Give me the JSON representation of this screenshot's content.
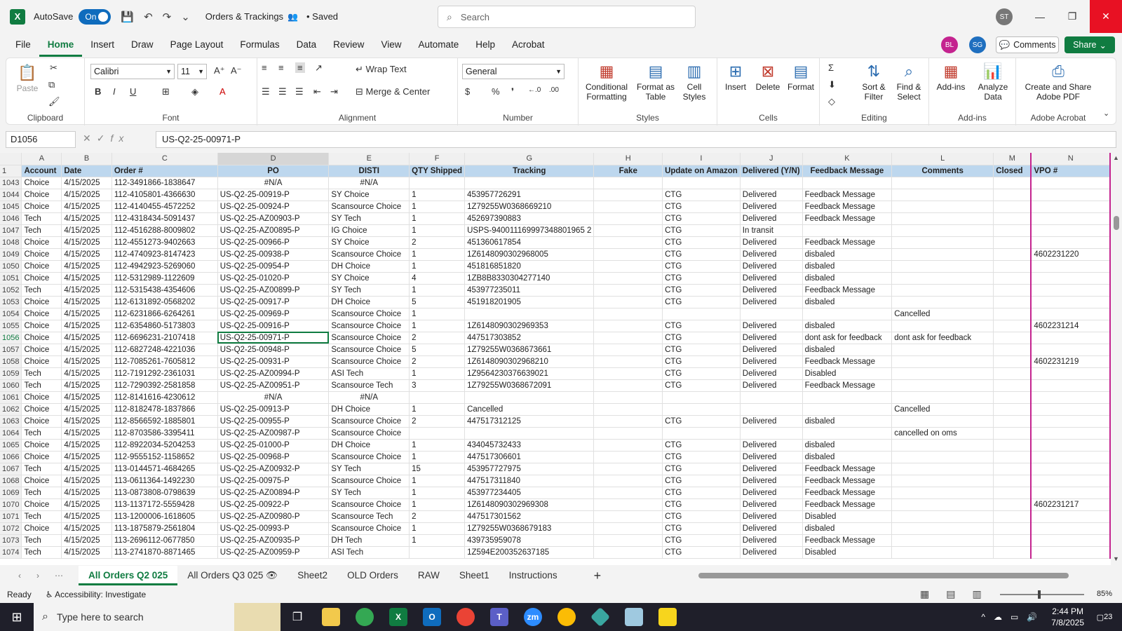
{
  "titlebar": {
    "autosave_label": "AutoSave",
    "autosave_state": "On",
    "doc_title": "Orders & Trackings",
    "saved": "• Saved",
    "search_placeholder": "Search",
    "user_initials": "ST",
    "minimize": "—",
    "maximize": "❐",
    "close": "✕"
  },
  "tabs": [
    "File",
    "Home",
    "Insert",
    "Draw",
    "Page Layout",
    "Formulas",
    "Data",
    "Review",
    "View",
    "Automate",
    "Help",
    "Acrobat"
  ],
  "collab": {
    "bl": "BL",
    "sg": "SG",
    "comments": "Comments",
    "share": "Share"
  },
  "ribbon": {
    "clipboard": {
      "label": "Clipboard",
      "paste": "Paste"
    },
    "font": {
      "label": "Font",
      "family": "Calibri",
      "size": "11"
    },
    "alignment": {
      "label": "Alignment",
      "wrap": "Wrap Text",
      "merge": "Merge & Center"
    },
    "number": {
      "label": "Number",
      "format": "General"
    },
    "styles": {
      "label": "Styles",
      "conditional": "Conditional Formatting",
      "format_table": "Format as Table",
      "cell_styles": "Cell Styles"
    },
    "cells": {
      "label": "Cells",
      "insert": "Insert",
      "delete": "Delete",
      "format": "Format"
    },
    "editing": {
      "label": "Editing",
      "sort": "Sort & Filter",
      "find": "Find & Select"
    },
    "addins": {
      "label": "Add-ins",
      "addins": "Add-ins",
      "analyze": "Analyze Data"
    },
    "acrobat": {
      "label": "Adobe Acrobat",
      "create": "Create and Share Adobe PDF"
    }
  },
  "formula_bar": {
    "name_box": "D1056",
    "formula": "US-Q2-25-00971-P"
  },
  "grid": {
    "col_letters": [
      "A",
      "B",
      "C",
      "D",
      "E",
      "F",
      "G",
      "H",
      "I",
      "J",
      "K",
      "L",
      "M",
      "N"
    ],
    "header_row_num": "1",
    "headers": [
      "Account",
      "Date",
      "Order #",
      "PO",
      "DISTI",
      "QTY Shipped",
      "Tracking",
      "Fake",
      "Update on Amazon",
      "Delivered (Y/N)",
      "Feedback Message",
      "Comments",
      "Closed",
      "VPO #"
    ],
    "rows": [
      [
        "1043",
        "Choice",
        "4/15/2025",
        "112-3491866-1838647",
        "#N/A",
        "#N/A",
        "",
        "",
        "",
        "",
        "",
        "",
        "",
        "",
        ""
      ],
      [
        "1044",
        "Choice",
        "4/15/2025",
        "112-4105801-4366630",
        "US-Q2-25-00919-P",
        "SY Choice",
        "1",
        "453957726291",
        "",
        "CTG",
        "Delivered",
        "Feedback Message",
        "",
        "",
        ""
      ],
      [
        "1045",
        "Choice",
        "4/15/2025",
        "112-4140455-4572252",
        "US-Q2-25-00924-P",
        "Scansource Choice",
        "1",
        "1Z79255W0368669210",
        "",
        "CTG",
        "Delivered",
        "Feedback Message",
        "",
        "",
        ""
      ],
      [
        "1046",
        "Tech",
        "4/15/2025",
        "112-4318434-5091437",
        "US-Q2-25-AZ00903-P",
        "SY Tech",
        "1",
        "452697390883",
        "",
        "CTG",
        "Delivered",
        "Feedback Message",
        "",
        "",
        ""
      ],
      [
        "1047",
        "Tech",
        "4/15/2025",
        "112-4516288-8009802",
        "US-Q2-25-AZ00895-P",
        "IG Choice",
        "1",
        "USPS-940011169997348801965 2",
        "",
        "CTG",
        "In transit",
        "",
        "",
        "",
        ""
      ],
      [
        "1048",
        "Choice",
        "4/15/2025",
        "112-4551273-9402663",
        "US-Q2-25-00966-P",
        "SY Choice",
        "2",
        "451360617854",
        "",
        "CTG",
        "Delivered",
        "Feedback Message",
        "",
        "",
        ""
      ],
      [
        "1049",
        "Choice",
        "4/15/2025",
        "112-4740923-8147423",
        "US-Q2-25-00938-P",
        "Scansource Choice",
        "1",
        "1Z6148090302968005",
        "",
        "CTG",
        "Delivered",
        "disbaled",
        "",
        "",
        "4602231220"
      ],
      [
        "1050",
        "Choice",
        "4/15/2025",
        "112-4942923-5269060",
        "US-Q2-25-00954-P",
        "DH Choice",
        "1",
        "451816851820",
        "",
        "CTG",
        "Delivered",
        "disbaled",
        "",
        "",
        ""
      ],
      [
        "1051",
        "Choice",
        "4/15/2025",
        "112-5312989-1122609",
        "US-Q2-25-01020-P",
        "SY Choice",
        "4",
        "1ZB8B8330304277140",
        "",
        "CTG",
        "Delivered",
        "disbaled",
        "",
        "",
        ""
      ],
      [
        "1052",
        "Tech",
        "4/15/2025",
        "112-5315438-4354606",
        "US-Q2-25-AZ00899-P",
        "SY Tech",
        "1",
        "453977235011",
        "",
        "CTG",
        "Delivered",
        "Feedback Message",
        "",
        "",
        ""
      ],
      [
        "1053",
        "Choice",
        "4/15/2025",
        "112-6131892-0568202",
        "US-Q2-25-00917-P",
        "DH Choice",
        "5",
        "451918201905",
        "",
        "CTG",
        "Delivered",
        "disbaled",
        "",
        "",
        ""
      ],
      [
        "1054",
        "Choice",
        "4/15/2025",
        "112-6231866-6264261",
        "US-Q2-25-00969-P",
        "Scansource Choice",
        "1",
        "",
        "",
        "",
        "",
        "",
        "Cancelled",
        "",
        ""
      ],
      [
        "1055",
        "Choice",
        "4/15/2025",
        "112-6354860-5173803",
        "US-Q2-25-00916-P",
        "Scansource Choice",
        "1",
        "1Z6148090302969353",
        "",
        "CTG",
        "Delivered",
        "disbaled",
        "",
        "",
        "4602231214"
      ],
      [
        "1056",
        "Choice",
        "4/15/2025",
        "112-6696231-2107418",
        "US-Q2-25-00971-P",
        "Scansource Choice",
        "2",
        "447517303852",
        "",
        "CTG",
        "Delivered",
        "dont ask for feedback",
        "dont ask for feedback",
        "",
        ""
      ],
      [
        "1057",
        "Choice",
        "4/15/2025",
        "112-6827248-4221036",
        "US-Q2-25-00948-P",
        "Scansource Choice",
        "5",
        "1Z79255W0368673661",
        "",
        "CTG",
        "Delivered",
        "disbaled",
        "",
        "",
        ""
      ],
      [
        "1058",
        "Choice",
        "4/15/2025",
        "112-7085261-7605812",
        "US-Q2-25-00931-P",
        "Scansource Choice",
        "2",
        "1Z6148090302968210",
        "",
        "CTG",
        "Delivered",
        "Feedback Message",
        "",
        "",
        "4602231219"
      ],
      [
        "1059",
        "Tech",
        "4/15/2025",
        "112-7191292-2361031",
        "US-Q2-25-AZ00994-P",
        "ASI Tech",
        "1",
        "1Z9564230376639021",
        "",
        "CTG",
        "Delivered",
        "Disabled",
        "",
        "",
        ""
      ],
      [
        "1060",
        "Tech",
        "4/15/2025",
        "112-7290392-2581858",
        "US-Q2-25-AZ00951-P",
        "Scansource Tech",
        "3",
        "1Z79255W0368672091",
        "",
        "CTG",
        "Delivered",
        "Feedback Message",
        "",
        "",
        ""
      ],
      [
        "1061",
        "Choice",
        "4/15/2025",
        "112-8141616-4230612",
        "#N/A",
        "#N/A",
        "",
        "",
        "",
        "",
        "",
        "",
        "",
        "",
        ""
      ],
      [
        "1062",
        "Choice",
        "4/15/2025",
        "112-8182478-1837866",
        "US-Q2-25-00913-P",
        "DH Choice",
        "1",
        "Cancelled",
        "",
        "",
        "",
        "",
        "Cancelled",
        "",
        ""
      ],
      [
        "1063",
        "Choice",
        "4/15/2025",
        "112-8566592-1885801",
        "US-Q2-25-00955-P",
        "Scansource Choice",
        "2",
        "447517312125",
        "",
        "CTG",
        "Delivered",
        "disbaled",
        "",
        "",
        ""
      ],
      [
        "1064",
        "Tech",
        "4/15/2025",
        "112-8703586-3395411",
        "US-Q2-25-AZ00987-P",
        "Scansource Choice",
        "",
        "",
        "",
        "",
        "",
        "",
        "cancelled on oms",
        "",
        ""
      ],
      [
        "1065",
        "Choice",
        "4/15/2025",
        "112-8922034-5204253",
        "US-Q2-25-01000-P",
        "DH Choice",
        "1",
        "434045732433",
        "",
        "CTG",
        "Delivered",
        "disbaled",
        "",
        "",
        ""
      ],
      [
        "1066",
        "Choice",
        "4/15/2025",
        "112-9555152-1158652",
        "US-Q2-25-00968-P",
        "Scansource Choice",
        "1",
        "447517306601",
        "",
        "CTG",
        "Delivered",
        "disbaled",
        "",
        "",
        ""
      ],
      [
        "1067",
        "Tech",
        "4/15/2025",
        "113-0144571-4684265",
        "US-Q2-25-AZ00932-P",
        "SY Tech",
        "15",
        "453957727975",
        "",
        "CTG",
        "Delivered",
        "Feedback Message",
        "",
        "",
        ""
      ],
      [
        "1068",
        "Choice",
        "4/15/2025",
        "113-0611364-1492230",
        "US-Q2-25-00975-P",
        "Scansource Choice",
        "1",
        "447517311840",
        "",
        "CTG",
        "Delivered",
        "Feedback Message",
        "",
        "",
        ""
      ],
      [
        "1069",
        "Tech",
        "4/15/2025",
        "113-0873808-0798639",
        "US-Q2-25-AZ00894-P",
        "SY Tech",
        "1",
        "453977234405",
        "",
        "CTG",
        "Delivered",
        "Feedback Message",
        "",
        "",
        ""
      ],
      [
        "1070",
        "Choice",
        "4/15/2025",
        "113-1137172-5559428",
        "US-Q2-25-00922-P",
        "Scansource Choice",
        "1",
        "1Z6148090302969308",
        "",
        "CTG",
        "Delivered",
        "Feedback Message",
        "",
        "",
        "4602231217"
      ],
      [
        "1071",
        "Tech",
        "4/15/2025",
        "113-1200006-1618605",
        "US-Q2-25-AZ00980-P",
        "Scansource Tech",
        "2",
        "447517301562",
        "",
        "CTG",
        "Delivered",
        "Disabled",
        "",
        "",
        ""
      ],
      [
        "1072",
        "Choice",
        "4/15/2025",
        "113-1875879-2561804",
        "US-Q2-25-00993-P",
        "Scansource Choice",
        "1",
        "1Z79255W0368679183",
        "",
        "CTG",
        "Delivered",
        "disbaled",
        "",
        "",
        ""
      ],
      [
        "1073",
        "Tech",
        "4/15/2025",
        "113-2696112-0677850",
        "US-Q2-25-AZ00935-P",
        "DH Tech",
        "1",
        "439735959078",
        "",
        "CTG",
        "Delivered",
        "Feedback Message",
        "",
        "",
        ""
      ],
      [
        "1074",
        "Tech",
        "4/15/2025",
        "113-2741870-8871465",
        "US-Q2-25-AZ00959-P",
        "ASI Tech",
        "",
        "1Z594E200352637185",
        "",
        "CTG",
        "Delivered",
        "Disabled",
        "",
        "",
        ""
      ]
    ]
  },
  "sheets": [
    "All Orders Q2 025",
    "All Orders Q3 025",
    "Sheet2",
    "OLD Orders",
    "RAW",
    "Sheet1",
    "Instructions"
  ],
  "status": {
    "ready": "Ready",
    "accessibility": "Accessibility: Investigate",
    "zoom": "85%"
  },
  "taskbar": {
    "search_placeholder": "Type here to search",
    "time": "2:44 PM",
    "date": "7/8/2025",
    "notifications": "23"
  },
  "colors": {
    "excel_green": "#107c41",
    "header_fill": "#bdd7ee",
    "collab_pink": "#c4238f",
    "close_red": "#e81123"
  }
}
